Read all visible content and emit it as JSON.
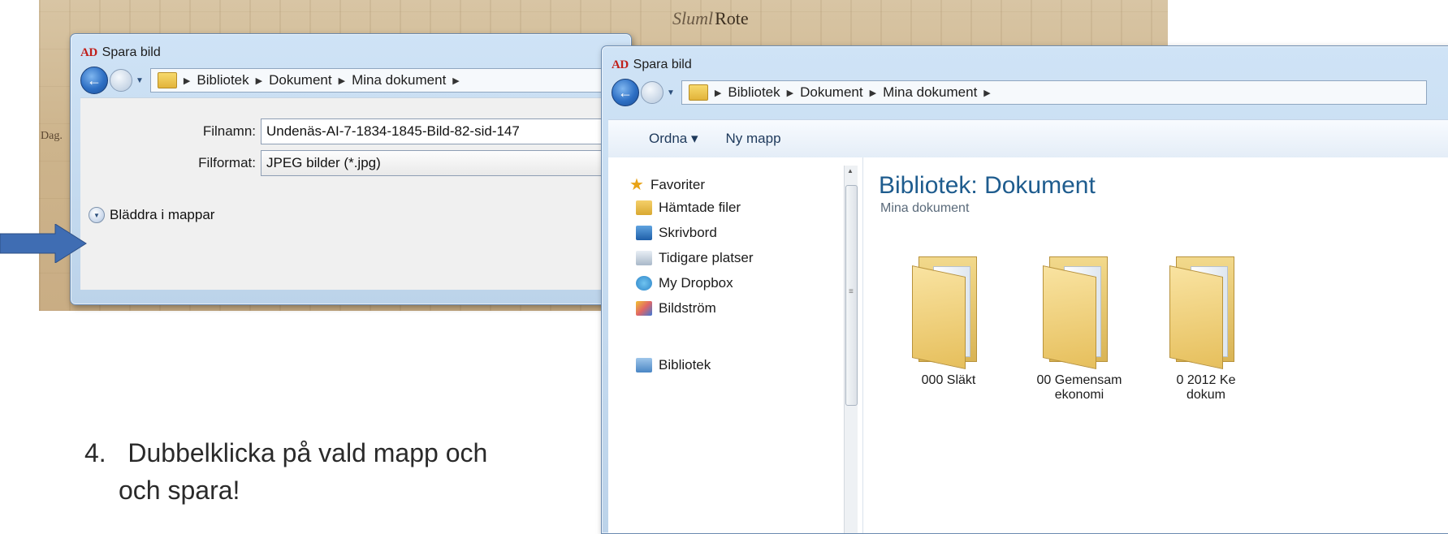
{
  "background": {
    "scan_word_italic": "Sluml",
    "scan_word": "Rote",
    "margin_text": "Dag."
  },
  "small_dialog": {
    "title": "Spara bild",
    "logo": "AD",
    "breadcrumb": [
      "Bibliotek",
      "Dokument",
      "Mina dokument"
    ],
    "filename_label": "Filnamn:",
    "filename_value": "Undenäs-AI-7-1834-1845-Bild-82-sid-147",
    "format_label": "Filformat:",
    "format_value": "JPEG bilder (*.jpg)",
    "browse_label": "Bläddra i mappar"
  },
  "big_dialog": {
    "title": "Spara bild",
    "logo": "AD",
    "breadcrumb": [
      "Bibliotek",
      "Dokument",
      "Mina dokument"
    ],
    "toolbar": {
      "organize": "Ordna ▾",
      "new_folder": "Ny mapp"
    },
    "nav": {
      "favorites": "Favoriter",
      "items": [
        "Hämtade filer",
        "Skrivbord",
        "Tidigare platser",
        "My Dropbox",
        "Bildström"
      ],
      "libraries": "Bibliotek"
    },
    "content": {
      "title": "Bibliotek: Dokument",
      "subtitle": "Mina dokument",
      "folders": [
        "000 Släkt",
        "00 Gemensam",
        "0 2012 Ke"
      ],
      "folders_line2": [
        "",
        "ekonomi",
        "dokum"
      ]
    }
  },
  "instruction": {
    "line1": "4.   Dubbelklicka på vald mapp och",
    "line2": "och spara!"
  },
  "colors": {
    "accent_arrow": "#3f6db3",
    "library_title": "#1e5c8e",
    "logo_red": "#c0201b"
  }
}
